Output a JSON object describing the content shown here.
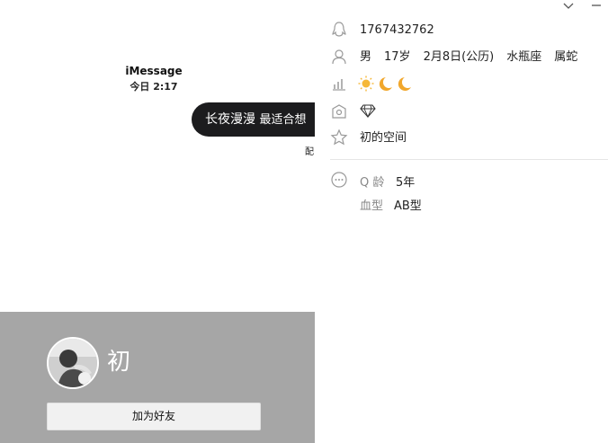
{
  "chat": {
    "service_name": "iMessage",
    "time": "今日 2:17",
    "bubble_main": "长夜漫漫",
    "bubble_tail": "最适合想",
    "delivered": "配"
  },
  "profile": {
    "nickname": "初",
    "add_friend_label": "加为好友"
  },
  "info": {
    "qq_number": "1767432762",
    "gender": "男",
    "age": "17岁",
    "birthday": "2月8日(公历)",
    "zodiac": "水瓶座",
    "chinese_zodiac": "属蛇",
    "level_icons": [
      "sun",
      "moon",
      "moon"
    ],
    "vip_icon": "diamond",
    "space_name": "初的空间",
    "qage_label": "Q 龄",
    "qage_value": "5年",
    "blood_label": "血型",
    "blood_value": "AB型"
  },
  "window_controls": {
    "collapse_icon": "chevron-down-icon",
    "minimize_icon": "minimize-icon"
  },
  "colors": {
    "bubble": "#1c1c1e",
    "cover": "#a6a6a6",
    "sun": "#f5b83a",
    "moon": "#f1a72c"
  }
}
